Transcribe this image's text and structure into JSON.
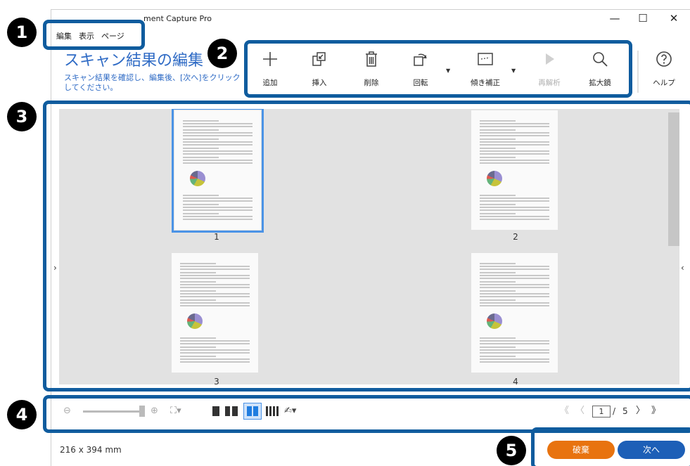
{
  "window": {
    "title": "ment Capture Pro",
    "minimize": "—",
    "maximize": "☐",
    "close": "✕"
  },
  "menu": [
    "編集",
    "表示",
    "ページ"
  ],
  "heading": "スキャン結果の編集",
  "subtext": "スキャン結果を確認し、編集後、[次へ]をクリックしてください。",
  "toolbar": {
    "add": "追加",
    "insert": "挿入",
    "delete": "削除",
    "rotate": "回転",
    "deskew": "傾き補正",
    "reanalyze": "再解析",
    "magnifier": "拡大鏡",
    "help": "ヘルプ"
  },
  "pages": [
    {
      "number": "1",
      "selected": true
    },
    {
      "number": "2",
      "selected": false
    },
    {
      "number": "3",
      "selected": false
    },
    {
      "number": "4",
      "selected": false
    }
  ],
  "pager": {
    "first": "《",
    "prev": "〈",
    "current": "1",
    "separator": "/",
    "total": "5",
    "next": "〉",
    "last": "》"
  },
  "status": {
    "page_size": "216 x 394 mm"
  },
  "buttons": {
    "discard": "破棄",
    "next": "次へ"
  },
  "markers": [
    "1",
    "2",
    "3",
    "4",
    "5"
  ],
  "colors": {
    "heading": "#2f6bc5",
    "highlight": "#0f5c9e",
    "discard": "#e8730f",
    "next": "#1d5fb7",
    "selection": "#4b93e6"
  }
}
